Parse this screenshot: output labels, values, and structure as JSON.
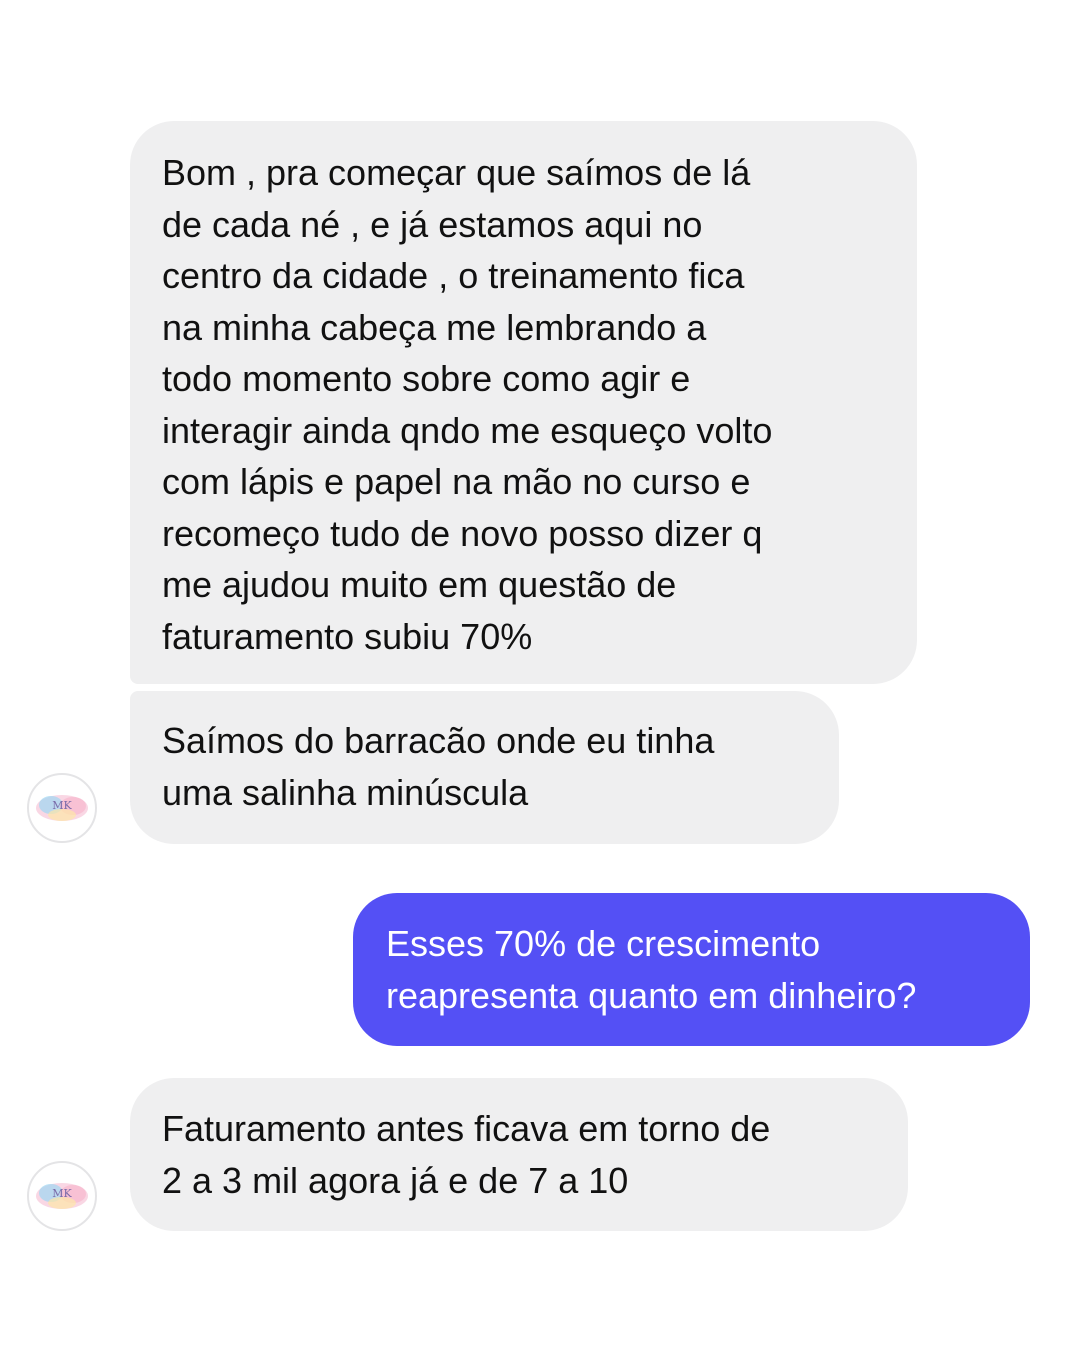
{
  "conversation": {
    "messages": [
      {
        "sender": "contact",
        "text": "Bom , pra começar que saímos de lá\nde cada né , e já estamos aqui no\ncentro da cidade , o treinamento fica\nna minha cabeça me lembrando a\ntodo momento sobre como agir e\ninteragir ainda qndo me esqueço volto\ncom lápis e papel na mão no curso e\nrecomeço tudo de novo posso dizer q\nme ajudou muito em questão de\nfaturamento subiu 70%"
      },
      {
        "sender": "contact",
        "text": "Saímos do barracão onde eu tinha\numa salinha minúscula"
      },
      {
        "sender": "me",
        "text": "Esses 70% de crescimento\nreapresenta quanto em dinheiro?"
      },
      {
        "sender": "contact",
        "text": "Faturamento antes ficava em torno de\n2 a 3 mil agora já e de 7 a 10"
      }
    ],
    "avatar": {
      "initials": "MK",
      "icon": "contact-avatar-icon"
    }
  },
  "colors": {
    "incoming_bubble": "#efeff0",
    "outgoing_bubble": "#5450f5",
    "background": "#ffffff"
  }
}
